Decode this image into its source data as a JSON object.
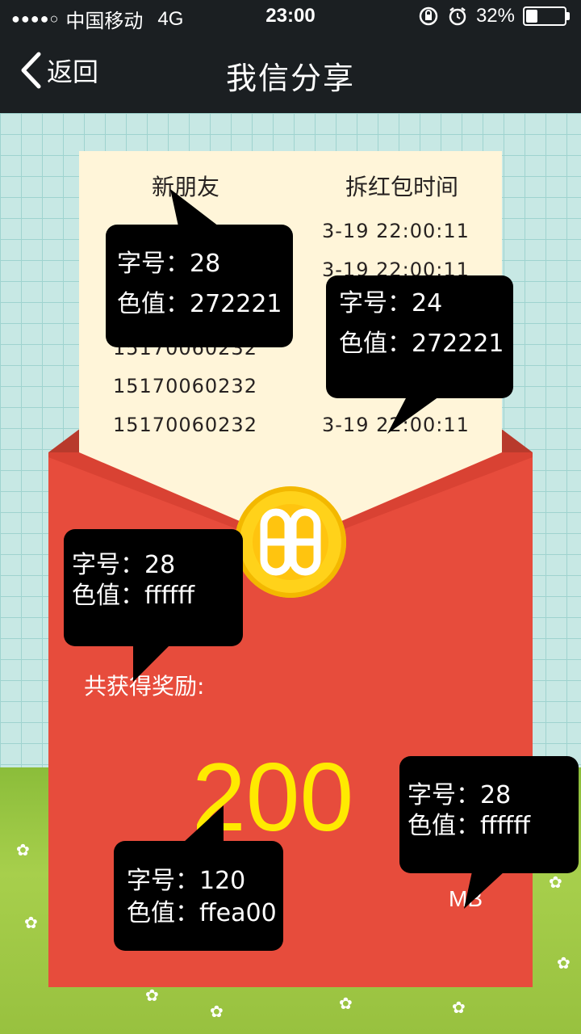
{
  "status_bar": {
    "signal_dots": "●●●●○",
    "carrier": "中国移动",
    "network": "4G",
    "time": "23:00",
    "battery_percent": "32%",
    "battery_level": 0.32
  },
  "nav": {
    "back_label": "返回",
    "title": "我信分享"
  },
  "table": {
    "headers": [
      "新朋友",
      "拆红包时间"
    ],
    "rows": [
      {
        "phone": "",
        "time": "3-19   22:00:11"
      },
      {
        "phone": "",
        "time": "3-19   22:00:11"
      },
      {
        "phone": "",
        "time": ""
      },
      {
        "phone": "15170060232",
        "time": ""
      },
      {
        "phone": "15170060232",
        "time": ""
      },
      {
        "phone": "15170060232",
        "time": "3-19   22:00:11"
      }
    ]
  },
  "reward": {
    "label": "共获得奖励:",
    "amount": "200",
    "unit": "MB"
  },
  "annotations": [
    {
      "line1": "字号：28",
      "line2": "色值：272221"
    },
    {
      "line1": "字号：24",
      "line2": "色值：272221"
    },
    {
      "line1": "字号：28",
      "line2": "色值：ffffff"
    },
    {
      "line1": "字号：120",
      "line2": "色值：ffea00"
    },
    {
      "line1": "字号：28",
      "line2": "色值：ffffff"
    }
  ],
  "colors": {
    "text_dark": "#272221",
    "white": "#ffffff",
    "amount_yellow": "#ffea00",
    "envelope_red": "#e74c3c",
    "navbar": "#1b1f22"
  }
}
